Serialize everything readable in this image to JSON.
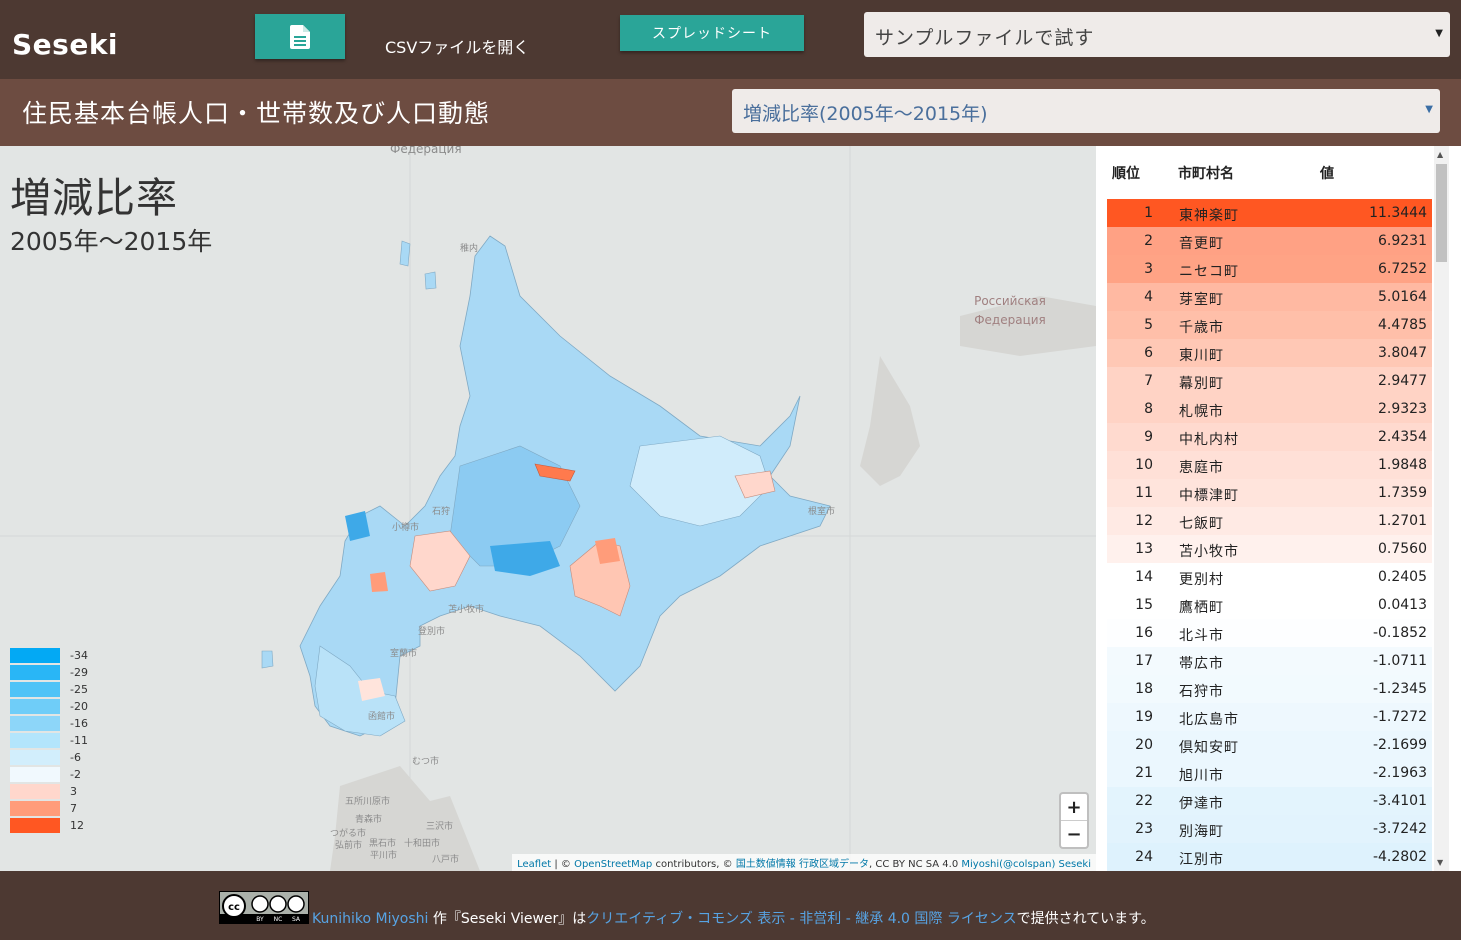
{
  "header": {
    "brand": "Seseki",
    "file_icon": "file-document-icon",
    "csv_label": "CSVファイルを開く",
    "spreadsheet_button": "スプレッドシート",
    "sample_select_value": "サンプルファイルで試す"
  },
  "subheader": {
    "dataset_title": "住民基本台帳人口・世帯数及び人口動態",
    "metric_select_value": "増減比率(2005年～2015年)"
  },
  "map": {
    "title": "増減比率",
    "subtitle": "2005年～2015年",
    "map_labels": [
      "Федерация",
      "Российская Федерация",
      "稚内",
      "石狩",
      "小樽市",
      "苫小牧市",
      "登別市",
      "室蘭市",
      "函館市",
      "むつ市",
      "三沢市",
      "青森市",
      "つがる市",
      "五所川原市",
      "弘前市",
      "十和田市",
      "八戸市",
      "黒石市",
      "平川市",
      "根室市"
    ],
    "legend": [
      {
        "label": "-34",
        "color": "#03a9f4"
      },
      {
        "label": "-29",
        "color": "#29b6f6"
      },
      {
        "label": "-25",
        "color": "#4fc3f7"
      },
      {
        "label": "-20",
        "color": "#6fcdf8"
      },
      {
        "label": "-16",
        "color": "#8dd6f9"
      },
      {
        "label": "-11",
        "color": "#b3e5fc"
      },
      {
        "label": "-6",
        "color": "#d2eefc"
      },
      {
        "label": "-2",
        "color": "#f1f9fe"
      },
      {
        "label": "3",
        "color": "#ffd7cc"
      },
      {
        "label": "7",
        "color": "#ff9c7a"
      },
      {
        "label": "12",
        "color": "#ff5722"
      }
    ],
    "zoom_in": "+",
    "zoom_out": "−",
    "attribution": {
      "leaflet": "Leaflet",
      "sep1": " | © ",
      "osm": "OpenStreetMap",
      "mid": " contributors, © ",
      "kokudo": "国土数値情報 行政区域データ",
      "license": ", CC BY NC SA 4.0 ",
      "author": "Miyoshi(@colspan) Seseki"
    }
  },
  "ranking": {
    "headers": {
      "rank": "順位",
      "name": "市町村名",
      "value": "値"
    },
    "rows": [
      {
        "rank": "1",
        "name": "東神楽町",
        "value": "11.3444",
        "color": "#ff5722"
      },
      {
        "rank": "2",
        "name": "音更町",
        "value": "6.9231",
        "color": "#ffa184"
      },
      {
        "rank": "3",
        "name": "ニセコ町",
        "value": "6.7252",
        "color": "#ffa385"
      },
      {
        "rank": "4",
        "name": "芽室町",
        "value": "5.0164",
        "color": "#ffb9a2"
      },
      {
        "rank": "5",
        "name": "千歳市",
        "value": "4.4785",
        "color": "#ffbfa9"
      },
      {
        "rank": "6",
        "name": "東川町",
        "value": "3.8047",
        "color": "#ffc8b5"
      },
      {
        "rank": "7",
        "name": "幕別町",
        "value": "2.9477",
        "color": "#ffd3c5"
      },
      {
        "rank": "8",
        "name": "札幌市",
        "value": "2.9323",
        "color": "#ffd3c5"
      },
      {
        "rank": "9",
        "name": "中札内村",
        "value": "2.4354",
        "color": "#ffdacf"
      },
      {
        "rank": "10",
        "name": "恵庭市",
        "value": "1.9848",
        "color": "#ffe0d7"
      },
      {
        "rank": "11",
        "name": "中標津町",
        "value": "1.7359",
        "color": "#ffe4dc"
      },
      {
        "rank": "12",
        "name": "七飯町",
        "value": "1.2701",
        "color": "#ffeae4"
      },
      {
        "rank": "13",
        "name": "苫小牧市",
        "value": "0.7560",
        "color": "#fff1ed"
      },
      {
        "rank": "14",
        "name": "更別村",
        "value": "0.2405",
        "color": "#ffffff"
      },
      {
        "rank": "15",
        "name": "鷹栖町",
        "value": "0.0413",
        "color": "#ffffff"
      },
      {
        "rank": "16",
        "name": "北斗市",
        "value": "-0.1852",
        "color": "#fdfeff"
      },
      {
        "rank": "17",
        "name": "帯広市",
        "value": "-1.0711",
        "color": "#f3fafe"
      },
      {
        "rank": "18",
        "name": "石狩市",
        "value": "-1.2345",
        "color": "#f2fafe"
      },
      {
        "rank": "19",
        "name": "北広島市",
        "value": "-1.7272",
        "color": "#eef8fe"
      },
      {
        "rank": "20",
        "name": "倶知安町",
        "value": "-2.1699",
        "color": "#ebf7fe"
      },
      {
        "rank": "21",
        "name": "旭川市",
        "value": "-2.1963",
        "color": "#ebf7fe"
      },
      {
        "rank": "22",
        "name": "伊達市",
        "value": "-3.4101",
        "color": "#e3f4fd"
      },
      {
        "rank": "23",
        "name": "別海町",
        "value": "-3.7242",
        "color": "#e2f3fd"
      },
      {
        "rank": "24",
        "name": "江別市",
        "value": "-4.2802",
        "color": "#def2fd"
      }
    ]
  },
  "footer": {
    "license_badge_icon": "cc-by-nc-sa-badge-icon",
    "author": "Kunihiko Miyoshi",
    "text1": " 作『Seseki Viewer』は",
    "license_link": "クリエイティブ・コモンズ 表示 - 非営利 - 継承 4.0 国際 ライセンス",
    "text2": "で提供されています。"
  }
}
